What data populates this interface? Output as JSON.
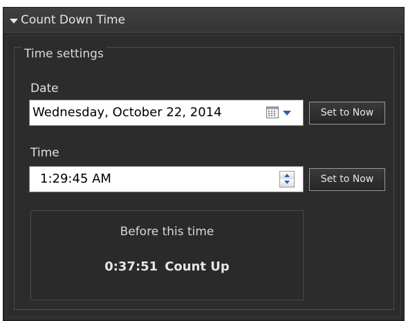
{
  "panel": {
    "title": "Count Down Time",
    "expander_icon": "triangle-down-icon"
  },
  "time_settings": {
    "legend": "Time settings",
    "date": {
      "label": "Date",
      "value": "Wednesday,  October  22, 2014",
      "calendar_icon": "calendar-icon",
      "dropdown_icon": "chevron-down-icon",
      "set_now_label": "Set to Now"
    },
    "time": {
      "label": "Time",
      "value": "1:29:45 AM",
      "spinner_icon": "spinner-icon",
      "set_now_label": "Set to Now"
    }
  },
  "countdown": {
    "caption": "Before this time",
    "elapsed": "0:37:51",
    "mode": "Count Up"
  },
  "colors": {
    "background": "#2b2b2b",
    "text": "#e6e6e6",
    "accent": "#2f5fb3"
  }
}
